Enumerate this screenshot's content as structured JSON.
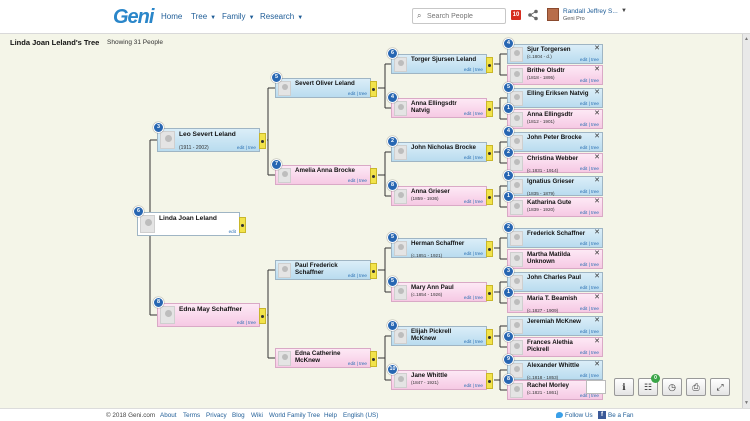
{
  "header": {
    "logo": "Geni",
    "nav": [
      {
        "label": "Home",
        "has_menu": false
      },
      {
        "label": "Tree",
        "has_menu": true
      },
      {
        "label": "Family",
        "has_menu": true
      },
      {
        "label": "Research",
        "has_menu": true
      }
    ],
    "search_placeholder": "Search People",
    "notification_count": "10",
    "user_name": "Randall Jeffrey S...",
    "user_subtitle": "Geni Pro"
  },
  "page": {
    "tree_title": "Linda Joan Leland's Tree",
    "showing": "Showing 31 People"
  },
  "tree": {
    "root": {
      "name": "Linda Joan Leland",
      "dates": "",
      "badge": "6",
      "gender": "sel",
      "edit": "edit"
    },
    "gen1": [
      {
        "name": "Leo Severt Leland",
        "dates": "(1911 - 2002)",
        "badge": "3",
        "gender": "m",
        "edit": "edit | tree"
      },
      {
        "name": "Edna May Schaffner",
        "dates": "",
        "badge": "8",
        "gender": "f",
        "edit": "edit | tree"
      }
    ],
    "gen2": [
      {
        "name": "Severt Oliver Leland",
        "dates": "",
        "badge": "5",
        "gender": "m",
        "edit": "edit | tree"
      },
      {
        "name": "Amelia Anna Brocke",
        "dates": "",
        "badge": "7",
        "gender": "f",
        "edit": "edit | tree"
      },
      {
        "name": "Paul Frederick Schaffner",
        "dates": "",
        "badge": "",
        "gender": "m",
        "edit": "edit | tree"
      },
      {
        "name": "Edna Catherine McKnew",
        "dates": "",
        "badge": "",
        "gender": "f",
        "edit": "edit | tree"
      }
    ],
    "gen3": [
      {
        "name": "Torger Sjursen Leland",
        "dates": "",
        "badge": "6",
        "gender": "m",
        "edit": "edit | tree"
      },
      {
        "name": "Anna Ellingsdtr Natvig",
        "dates": "",
        "badge": "4",
        "gender": "f",
        "edit": "edit | tree"
      },
      {
        "name": "John Nicholas Brocke",
        "dates": "",
        "badge": "2",
        "gender": "m",
        "edit": "edit | tree"
      },
      {
        "name": "Anna Grieser",
        "dates": "(1859 - 1936)",
        "badge": "8",
        "gender": "f",
        "edit": "edit | tree"
      },
      {
        "name": "Herman Schaffner",
        "dates": "(c.1851 - 1921)",
        "badge": "5",
        "gender": "m",
        "edit": "edit | tree"
      },
      {
        "name": "Mary Ann Paul",
        "dates": "(c.1854 - 1926)",
        "badge": "5",
        "gender": "f",
        "edit": "edit | tree"
      },
      {
        "name": "Elijah Pickrell McKnew",
        "dates": "",
        "badge": "8",
        "gender": "m",
        "edit": "edit | tree"
      },
      {
        "name": "Jane Whittle",
        "dates": "(1847 - 1921)",
        "badge": "10",
        "gender": "f",
        "edit": "edit | tree"
      }
    ],
    "gen4": [
      {
        "name": "Sjur Torgersen",
        "dates": "(c.1804 - d.)",
        "badge": "4",
        "gender": "m",
        "edit": "edit | tree"
      },
      {
        "name": "Brithe Olsdtr",
        "dates": "(1818 - 1895)",
        "badge": "",
        "gender": "f",
        "edit": "edit | tree"
      },
      {
        "name": "Elling Eriksen Natvig",
        "dates": "",
        "badge": "5",
        "gender": "m",
        "edit": "edit | tree"
      },
      {
        "name": "Anna Ellingsdtr",
        "dates": "(1812 - 1901)",
        "badge": "1",
        "gender": "f",
        "edit": "edit | tree"
      },
      {
        "name": "John Peter Brocke",
        "dates": "",
        "badge": "4",
        "gender": "m",
        "edit": "edit | tree"
      },
      {
        "name": "Christina Webber",
        "dates": "(c.1831 - 1914)",
        "badge": "2",
        "gender": "f",
        "edit": "edit | tree"
      },
      {
        "name": "Ignatius Grieser",
        "dates": "(1835 - 1879)",
        "badge": "1",
        "gender": "m",
        "edit": "edit | tree"
      },
      {
        "name": "Katharina Gute",
        "dates": "(1839 - 1920)",
        "badge": "1",
        "gender": "f",
        "edit": "edit | tree"
      },
      {
        "name": "Frederick Schaffner",
        "dates": "",
        "badge": "2",
        "gender": "m",
        "edit": "edit | tree"
      },
      {
        "name": "Martha Matilda Unknown",
        "dates": "",
        "badge": "",
        "gender": "f",
        "edit": "edit | tree"
      },
      {
        "name": "John Charles Paul",
        "dates": "",
        "badge": "3",
        "gender": "m",
        "edit": "edit | tree"
      },
      {
        "name": "Maria T. Beamish",
        "dates": "(c.1827 - 1909)",
        "badge": "1",
        "gender": "f",
        "edit": "edit | tree"
      },
      {
        "name": "Jeremiah McKnew",
        "dates": "",
        "badge": "",
        "gender": "m",
        "edit": "edit | tree"
      },
      {
        "name": "Frances Alethia Pickrell",
        "dates": "",
        "badge": "6",
        "gender": "f",
        "edit": "edit | tree"
      },
      {
        "name": "Alexander Whittle",
        "dates": "(c.1818 - 1853)",
        "badge": "9",
        "gender": "m",
        "edit": "edit | tree"
      },
      {
        "name": "Rachel Morley",
        "dates": "(c.1821 - 1861)",
        "badge": "8",
        "gender": "f",
        "edit": "edit | tree"
      }
    ]
  },
  "tools": {
    "badge": "0"
  },
  "footer": {
    "copyright": "© 2018 Geni.com",
    "links": [
      "About",
      "Terms",
      "Privacy",
      "Blog",
      "Wiki",
      "World Family Tree",
      "Help",
      "English (US)"
    ],
    "follow": "Follow Us",
    "fan": "Be a Fan"
  },
  "colors": {
    "brand": "#2a86c9",
    "male_card": "#b9dcef",
    "female_card": "#f6c9e4",
    "badge": "#2766b2"
  }
}
